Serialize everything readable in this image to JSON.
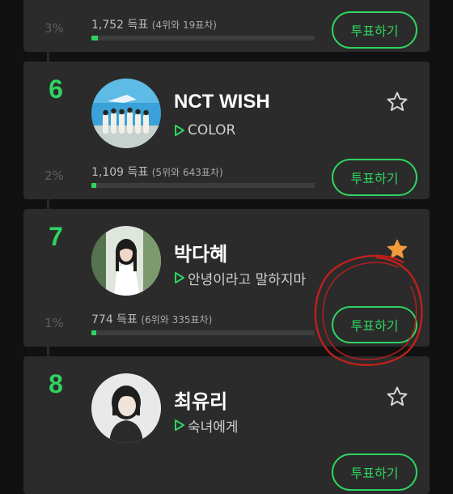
{
  "ranking": [
    {
      "rank": "",
      "name": "",
      "song": "",
      "favorite": false,
      "percent": "3%",
      "votes": "1,752 득표",
      "gap": "(4위와 19표차)",
      "share": 0.03,
      "vote_label": "투표하기"
    },
    {
      "rank": "6",
      "name": "NCT WISH",
      "song": "COLOR",
      "favorite": false,
      "percent": "2%",
      "votes": "1,109 득표",
      "gap": "(5위와 643표차)",
      "share": 0.02,
      "vote_label": "투표하기"
    },
    {
      "rank": "7",
      "name": "박다혜",
      "song": "안녕이라고 말하지마",
      "favorite": true,
      "percent": "1%",
      "votes": "774 득표",
      "gap": "(6위와 335표차)",
      "share": 0.01,
      "vote_label": "투표하기"
    },
    {
      "rank": "8",
      "name": "최유리",
      "song": "숙녀에게",
      "favorite": false,
      "percent": "",
      "votes": "",
      "gap": "",
      "share": 0,
      "vote_label": "투표하기"
    }
  ],
  "colors": {
    "accent": "#2fd460",
    "favorite_star": "#f29a3c",
    "annotation": "#c0201c"
  },
  "icons": {
    "play": "play-triangle-icon",
    "star_empty": "star-outline-icon",
    "star_filled": "star-filled-icon"
  }
}
